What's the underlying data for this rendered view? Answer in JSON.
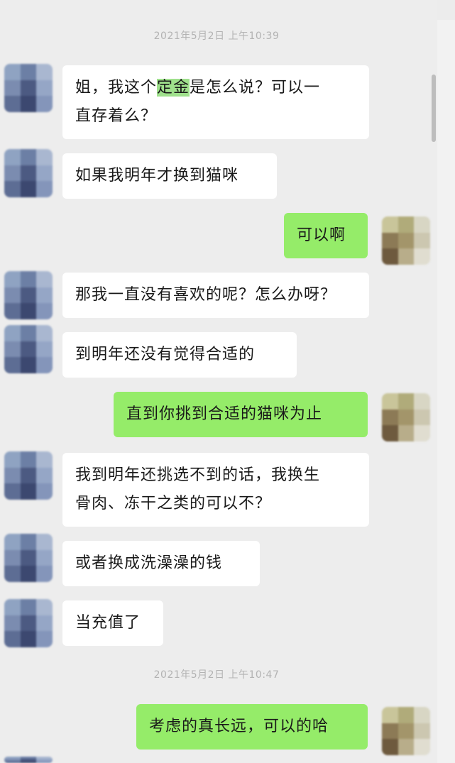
{
  "timestamps": [
    "2021年5月2日 上午10:39",
    "2021年5月2日 上午10:47"
  ],
  "messages": [
    {
      "side": "in",
      "line1": "姐，我这个",
      "highlight": "定金",
      "line1_end": "是怎么说？可以一",
      "line2": "直存着么？"
    },
    {
      "side": "in",
      "text": "如果我明年才换到猫咪"
    },
    {
      "side": "out",
      "text": "可以啊"
    },
    {
      "side": "in",
      "text": "那我一直没有喜欢的呢？怎么办呀？"
    },
    {
      "side": "in",
      "text": "到明年还没有觉得合适的"
    },
    {
      "side": "out",
      "text": "直到你挑到合适的猫咪为止"
    },
    {
      "side": "in",
      "line1": "我到明年还挑选不到的话，我换生",
      "line2": "骨肉、冻干之类的可以不？"
    },
    {
      "side": "in",
      "text": "或者换成洗澡澡的钱"
    },
    {
      "side": "in",
      "text": "当充值了"
    },
    {
      "side": "out",
      "text": "考虑的真长远，可以的哈"
    }
  ],
  "colors": {
    "incoming": "#ffffff",
    "outgoing": "#95ec69",
    "background": "#ededed"
  }
}
